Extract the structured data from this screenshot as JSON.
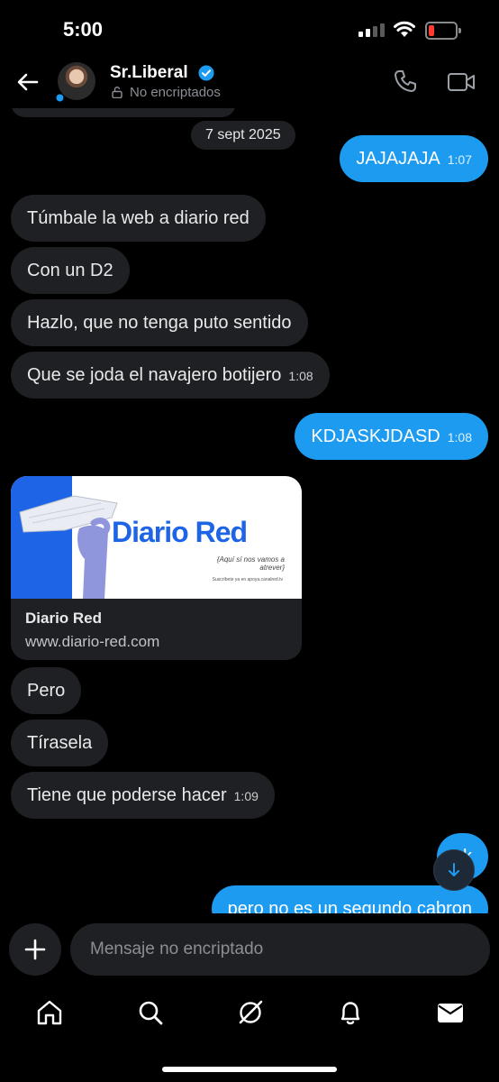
{
  "status_bar": {
    "time": "5:00"
  },
  "header": {
    "contact_name": "Sr.Liberal",
    "encryption_status": "No encriptados"
  },
  "conversation": {
    "date_divider": "7 sept 2025",
    "messages": [
      {
        "direction": "outgoing",
        "text": "JAJAJAJA",
        "time": "1:07"
      },
      {
        "direction": "incoming",
        "text": "Túmbale la web a diario red",
        "time": ""
      },
      {
        "direction": "incoming",
        "text": "Con un D2",
        "time": ""
      },
      {
        "direction": "incoming",
        "text": "Hazlo, que no tenga puto sentido",
        "time": ""
      },
      {
        "direction": "incoming",
        "text": "Que se joda el navajero botijero",
        "time": "1:08"
      },
      {
        "direction": "outgoing",
        "text": "KDJASKJDASD",
        "time": "1:08"
      },
      {
        "direction": "incoming",
        "text": "Pero",
        "time": ""
      },
      {
        "direction": "incoming",
        "text": "Tírasela",
        "time": ""
      },
      {
        "direction": "incoming",
        "text": "Tiene que poderse hacer",
        "time": "1:09"
      },
      {
        "direction": "outgoing",
        "text": "ok",
        "time": ""
      },
      {
        "direction": "outgoing",
        "text": "pero no es un segundo cabron",
        "time": ""
      }
    ],
    "link_preview": {
      "title": "Diario Red",
      "url": "www.diario-red.com",
      "image_logo": "Diario Red",
      "image_tagline": "{Aquí sí nos vamos a atrever}",
      "image_subscribe": "Suscríbete ya en apoya.canalred.tv"
    }
  },
  "composer": {
    "placeholder": "Mensaje no encriptado"
  },
  "tabbar": {
    "items": [
      "home-icon",
      "search-icon",
      "grok-icon",
      "bell-icon",
      "mail-icon"
    ]
  },
  "colors": {
    "background": "#000000",
    "incoming_bubble": "#1f2023",
    "outgoing_bubble": "#1d9bf0",
    "verified": "#1d9bf0",
    "battery_low": "#ff3b30"
  }
}
